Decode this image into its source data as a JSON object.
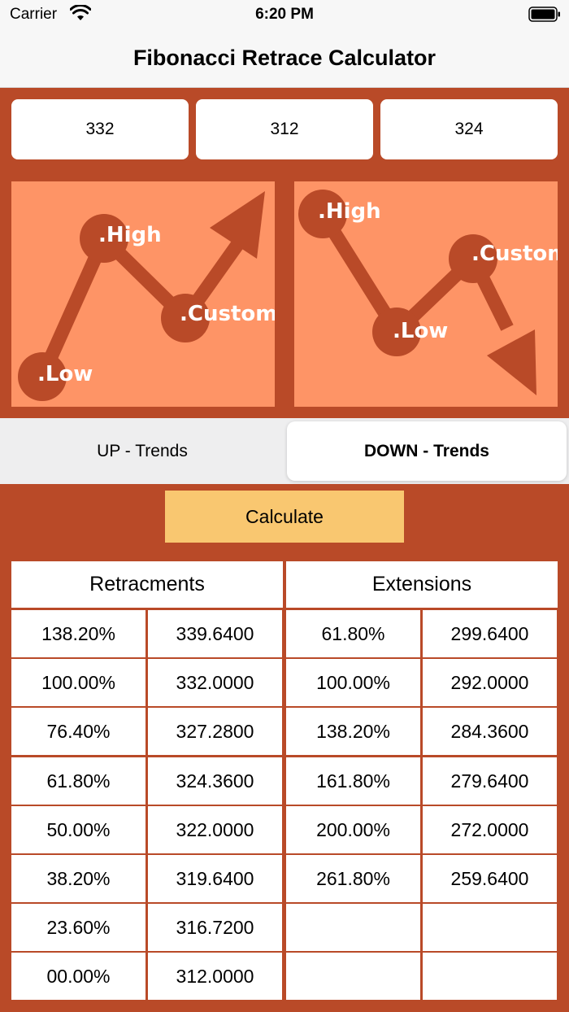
{
  "status_bar": {
    "carrier": "Carrier",
    "time": "6:20 PM",
    "icons": [
      "wifi-icon",
      "battery-icon"
    ]
  },
  "nav": {
    "title": "Fibonacci Retrace Calculator"
  },
  "inputs": {
    "high": "332",
    "low": "312",
    "custom": "324"
  },
  "diagrams": {
    "up": {
      "high": ".High",
      "custom": ".Custom",
      "low": ".Low"
    },
    "down": {
      "high": ".High",
      "custom": ".Custom",
      "low": ".Low"
    }
  },
  "trend_selector": {
    "up_label": "UP - Trends",
    "down_label": "DOWN - Trends",
    "selected": "DOWN - Trends"
  },
  "calculate_label": "Calculate",
  "results": {
    "retracements_header": "Retracments",
    "extensions_header": "Extensions",
    "retracements": [
      [
        "138.20%",
        "339.6400"
      ],
      [
        "100.00%",
        "332.0000"
      ],
      [
        "76.40%",
        "327.2800"
      ],
      [
        "61.80%",
        "324.3600"
      ],
      [
        "50.00%",
        "322.0000"
      ],
      [
        "38.20%",
        "319.6400"
      ],
      [
        "23.60%",
        "316.7200"
      ],
      [
        "00.00%",
        "312.0000"
      ]
    ],
    "extensions": [
      [
        "61.80%",
        "299.6400"
      ],
      [
        "100.00%",
        "292.0000"
      ],
      [
        "138.20%",
        "284.3600"
      ],
      [
        "161.80%",
        "279.6400"
      ],
      [
        "200.00%",
        "272.0000"
      ],
      [
        "261.80%",
        "259.6400"
      ],
      [
        "",
        ""
      ],
      [
        "",
        ""
      ]
    ]
  },
  "colors": {
    "background": "#b94a28",
    "diagram_fill": "#fe9466",
    "button": "#f9c770"
  }
}
